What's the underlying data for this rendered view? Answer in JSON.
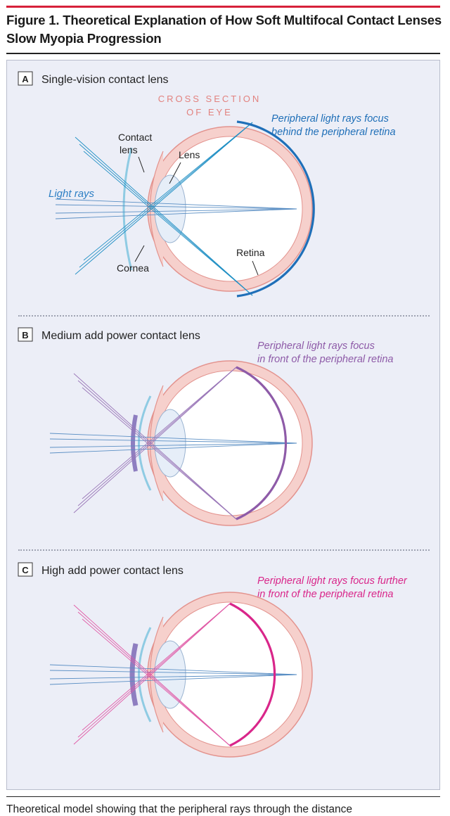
{
  "figure": {
    "title": "Figure 1. Theoretical Explanation of How Soft Multifocal Contact Lenses Slow Myopia Progression",
    "caption": "Theoretical model showing that the peripheral rays through the distance"
  },
  "panels": [
    {
      "letter": "A",
      "title": "Single-vision contact lens",
      "cross_section_1": "CROSS SECTION",
      "cross_section_2": "OF EYE",
      "note_1": "Peripheral light rays focus",
      "note_2": "behind the peripheral retina",
      "labels": {
        "contact_1": "Contact",
        "contact_2": "lens",
        "lens": "Lens",
        "light_rays": "Light rays",
        "retina": "Retina",
        "cornea": "Cornea"
      }
    },
    {
      "letter": "B",
      "title": "Medium add power contact lens",
      "note_1": "Peripheral light rays focus",
      "note_2": "in front of the peripheral retina"
    },
    {
      "letter": "C",
      "title": "High add power contact lens",
      "note_1": "Peripheral light rays focus further",
      "note_2": "in front of the peripheral retina"
    }
  ],
  "colors": {
    "accent_red": "#d6213a",
    "panel_a": "#1f6fb8",
    "panel_b": "#8e5ba8",
    "panel_c": "#d9268a",
    "central_ray": "#5b8fc4",
    "eye_fill": "#f6d0cc",
    "eye_stroke": "#e3938e"
  }
}
